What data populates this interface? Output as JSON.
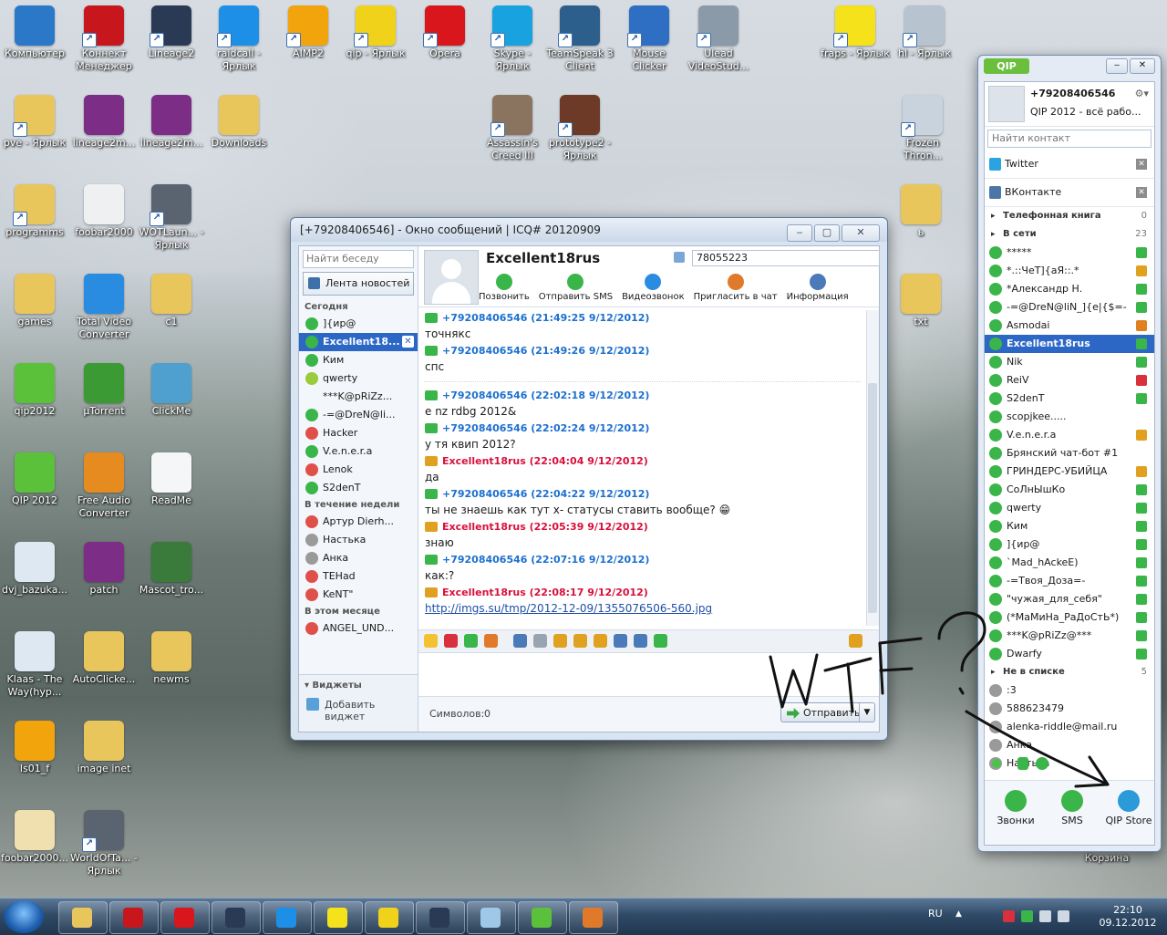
{
  "desktop": {
    "icons": [
      {
        "label": "Компьютер",
        "color": "#2b78c8",
        "shortcut": false
      },
      {
        "label": "Коннект Менеджер",
        "color": "#c8161d",
        "shortcut": true
      },
      {
        "label": "Lineage2",
        "color": "#2a3a55",
        "shortcut": true
      },
      {
        "label": "raidcall - Ярлык",
        "color": "#1e8fe6",
        "shortcut": true
      },
      {
        "label": "AIMP2",
        "color": "#f2a40d",
        "shortcut": true
      },
      {
        "label": "qip - Ярлык",
        "color": "#f1d21b",
        "shortcut": true
      },
      {
        "label": "Opera",
        "color": "#d8161c",
        "shortcut": true
      },
      {
        "label": "Skype - Ярлык",
        "color": "#19a2e0",
        "shortcut": true
      },
      {
        "label": "TeamSpeak 3 Client",
        "color": "#2d5f8d",
        "shortcut": true
      },
      {
        "label": "Mouse Clicker",
        "color": "#2e6fc4",
        "shortcut": true
      },
      {
        "label": "Ulead VideoStud...",
        "color": "#8b9aa8",
        "shortcut": true
      },
      {
        "label": "fraps - Ярлык",
        "color": "#f5e21a",
        "shortcut": true
      },
      {
        "label": "hl - Ярлык",
        "color": "#b7c3cf",
        "shortcut": true
      },
      {
        "label": "pve - Ярлык",
        "color": "#e8c65b",
        "shortcut": true
      },
      {
        "label": "lineage2m...",
        "color": "#7c2e86",
        "shortcut": false
      },
      {
        "label": "lineage2m...",
        "color": "#7c2e86",
        "shortcut": false
      },
      {
        "label": "Downloads",
        "color": "#e8c65b",
        "shortcut": false
      },
      {
        "label": "Assassin's Creed III",
        "color": "#8a7460",
        "shortcut": true
      },
      {
        "label": "prototype2 - Ярлык",
        "color": "#6d3a28",
        "shortcut": true
      },
      {
        "label": "Frozen Thron...",
        "color": "#c9d3de",
        "shortcut": true
      },
      {
        "label": "programms",
        "color": "#e8c65b",
        "shortcut": true
      },
      {
        "label": "foobar2000",
        "color": "#eef0f2",
        "shortcut": false
      },
      {
        "label": "WOTLaun... - Ярлык",
        "color": "#5a6470",
        "shortcut": true
      },
      {
        "label": "games",
        "color": "#e8c65b",
        "shortcut": false
      },
      {
        "label": "Total Video Converter",
        "color": "#2a8ce0",
        "shortcut": false
      },
      {
        "label": "c1",
        "color": "#e8c65b",
        "shortcut": false
      },
      {
        "label": "qip2012",
        "color": "#5cc13a",
        "shortcut": false
      },
      {
        "label": "µTorrent",
        "color": "#3c9a35",
        "shortcut": false
      },
      {
        "label": "ClickMe",
        "color": "#4fa0cf",
        "shortcut": false
      },
      {
        "label": "QIP 2012",
        "color": "#5cc13a",
        "shortcut": false
      },
      {
        "label": "Free Audio Converter",
        "color": "#e58b1f",
        "shortcut": false
      },
      {
        "label": "ReadMe",
        "color": "#f4f6f8",
        "shortcut": false
      },
      {
        "label": "dvj_bazuka...",
        "color": "#dde8f3",
        "shortcut": false
      },
      {
        "label": "patch",
        "color": "#7c2e86",
        "shortcut": false
      },
      {
        "label": "Mascot_tro...",
        "color": "#3a7a3a",
        "shortcut": false
      },
      {
        "label": "Klaas - The Way(hyp...",
        "color": "#dde8f3",
        "shortcut": false
      },
      {
        "label": "AutoClicke...",
        "color": "#e8c65b",
        "shortcut": false
      },
      {
        "label": "newms",
        "color": "#e8c65b",
        "shortcut": false
      },
      {
        "label": "ls01_f",
        "color": "#f2a40d",
        "shortcut": false
      },
      {
        "label": "image inet",
        "color": "#e8c65b",
        "shortcut": false
      },
      {
        "label": "foobar2000...",
        "color": "#f0e0b0",
        "shortcut": false
      },
      {
        "label": "WorldOfTa... - Ярлык",
        "color": "#5a6470",
        "shortcut": true
      },
      {
        "label": "ь",
        "color": "#e8c65b",
        "shortcut": false
      },
      {
        "label": "txt",
        "color": "#e8c65b",
        "shortcut": false
      },
      {
        "label": "Корзина",
        "color": "#c9d3de",
        "shortcut": false
      }
    ]
  },
  "msgwin": {
    "title": "[+79208406546] - Окно сообщений | ICQ# 20120909",
    "search_placeholder": "Найти беседу",
    "news_label": "Лента новостей",
    "sections": [
      {
        "title": "Сегодня",
        "items": [
          {
            "label": "]{ир@",
            "flower": "#3ab54a",
            "selected": false
          },
          {
            "label": "Excellent18...",
            "flower": "#3ab54a",
            "selected": true
          },
          {
            "label": "Ким",
            "flower": "#3ab54a",
            "selected": false
          },
          {
            "label": "qwerty",
            "flower": "#9acb3c",
            "selected": false
          },
          {
            "label": "***K@pRiZz...",
            "flower": "",
            "selected": false
          },
          {
            "label": "-=@DreN@li...",
            "flower": "#3ab54a",
            "selected": false
          },
          {
            "label": "Hacker",
            "flower": "#e0504a",
            "selected": false
          },
          {
            "label": "V.e.n.e.r.a",
            "flower": "#3ab54a",
            "selected": false
          },
          {
            "label": "Lenok",
            "flower": "#e0504a",
            "selected": false
          },
          {
            "label": "S2denT",
            "flower": "#3ab54a",
            "selected": false
          }
        ]
      },
      {
        "title": "В течение недели",
        "items": [
          {
            "label": "Артур Dierh...",
            "flower": "#e0504a",
            "selected": false
          },
          {
            "label": "Настька",
            "flower": "#9a9a9a",
            "selected": false
          },
          {
            "label": "Анка",
            "flower": "#9a9a9a",
            "selected": false
          },
          {
            "label": "TEHad",
            "flower": "#e0504a",
            "selected": false
          },
          {
            "label": "KeNT\"",
            "flower": "#e0504a",
            "selected": false
          }
        ]
      },
      {
        "title": "В этом месяце",
        "items": [
          {
            "label": "ANGEL_UND...",
            "flower": "#e0504a",
            "selected": false
          }
        ]
      }
    ],
    "widgets_label": "Виджеты",
    "add_widget_label": "Добавить виджет",
    "contact_name": "Excellent18rus",
    "contact_number": "78055223",
    "actions": [
      {
        "label": "Позвонить",
        "color": "#3ab54a"
      },
      {
        "label": "Отправить SMS",
        "color": "#3ab54a"
      },
      {
        "label": "Видеозвонок",
        "color": "#2a8ce0"
      },
      {
        "label": "Пригласить в чат",
        "color": "#e07a2a"
      },
      {
        "label": "Информация",
        "color": "#4a7ab8"
      }
    ],
    "messages": [
      {
        "who": "me",
        "header": "+79208406546 (21:49:25 9/12/2012)",
        "text": "точнякс"
      },
      {
        "who": "me",
        "header": "+79208406546 (21:49:26 9/12/2012)",
        "text": "спс"
      },
      {
        "who": "sep"
      },
      {
        "who": "me",
        "header": "+79208406546 (22:02:18 9/12/2012)",
        "text": "е nz rdbg 2012&"
      },
      {
        "who": "me",
        "header": "+79208406546 (22:02:24 9/12/2012)",
        "text": "у тя квип 2012?"
      },
      {
        "who": "them",
        "header": "Excellent18rus (22:04:04 9/12/2012)",
        "text": "да"
      },
      {
        "who": "me",
        "header": "+79208406546 (22:04:22 9/12/2012)",
        "text": "ты не знаешь как тут х- статусы ставить вообще? 😁"
      },
      {
        "who": "them",
        "header": "Excellent18rus (22:05:39 9/12/2012)",
        "text": "знаю"
      },
      {
        "who": "me",
        "header": "+79208406546 (22:07:16 9/12/2012)",
        "text": "как:?"
      },
      {
        "who": "them",
        "header": "Excellent18rus (22:08:17 9/12/2012)",
        "text": "http://imgs.su/tmp/2012-12-09/1355076506-560.jpg",
        "link": true
      }
    ],
    "chars_label": "Символов:",
    "chars_count": "0",
    "send_label": "Отправить"
  },
  "qip": {
    "tab_label": "QIP",
    "phone": "+79208406546",
    "status": "QIP 2012 - всё рабо...",
    "search_placeholder": "Найти контакт",
    "services": [
      {
        "label": "Twitter",
        "color": "#2aa3e0"
      },
      {
        "label": "ВКонтакте",
        "color": "#4a76a8"
      }
    ],
    "phonebook_label": "Телефонная книга",
    "phonebook_count": "0",
    "online_label": "В сети",
    "online_count": "23",
    "contacts": [
      {
        "label": "*****",
        "flower": "#3ab54a",
        "ricon": "#3ab54a",
        "selected": false
      },
      {
        "label": "*.::ЧеТ]{аЯ::.*",
        "flower": "#3ab54a",
        "ricon": "#e0a020",
        "selected": false
      },
      {
        "label": "*Александр Н.",
        "flower": "#3ab54a",
        "ricon": "#3ab54a",
        "selected": false
      },
      {
        "label": "-=@DreN@liN_]{e|{$=-",
        "flower": "#3ab54a",
        "ricon": "#3ab54a",
        "selected": false
      },
      {
        "label": "Asmodai",
        "flower": "#3ab54a",
        "ricon": "#e08020",
        "selected": false
      },
      {
        "label": "Excellent18rus",
        "flower": "#3ab54a",
        "ricon": "#3ab54a",
        "selected": true
      },
      {
        "label": "Nik",
        "flower": "#3ab54a",
        "ricon": "#3ab54a",
        "selected": false
      },
      {
        "label": "ReiV",
        "flower": "#3ab54a",
        "ricon": "#d8303c",
        "selected": false
      },
      {
        "label": "S2denT",
        "flower": "#3ab54a",
        "ricon": "#3ab54a",
        "selected": false
      },
      {
        "label": "scopjkee.....",
        "flower": "#3ab54a",
        "ricon": "",
        "selected": false
      },
      {
        "label": "V.e.n.e.r.a",
        "flower": "#3ab54a",
        "ricon": "#e0a020",
        "selected": false
      },
      {
        "label": "Брянский чат-бот #1",
        "flower": "#3ab54a",
        "ricon": "",
        "selected": false
      },
      {
        "label": "ГРИНДЕРС-УБИЙЦА",
        "flower": "#3ab54a",
        "ricon": "#e0a020",
        "selected": false
      },
      {
        "label": "СоЛнЫшКо",
        "flower": "#3ab54a",
        "ricon": "#3ab54a",
        "selected": false
      },
      {
        "label": "qwerty",
        "flower": "#3ab54a",
        "ricon": "#3ab54a",
        "selected": false
      },
      {
        "label": "Ким",
        "flower": "#3ab54a",
        "ricon": "#3ab54a",
        "selected": false
      },
      {
        "label": "]{ир@",
        "flower": "#3ab54a",
        "ricon": "#3ab54a",
        "selected": false
      },
      {
        "label": "`Mad_hAckeE)",
        "flower": "#3ab54a",
        "ricon": "#3ab54a",
        "selected": false
      },
      {
        "label": "-=Твоя_Доза=-",
        "flower": "#3ab54a",
        "ricon": "#3ab54a",
        "selected": false
      },
      {
        "label": "\"чужая_для_себя\"",
        "flower": "#3ab54a",
        "ricon": "#3ab54a",
        "selected": false
      },
      {
        "label": "(*МаМиНа_РаДоСтЬ*)",
        "flower": "#3ab54a",
        "ricon": "#3ab54a",
        "selected": false
      },
      {
        "label": "***K@pRiZz@***",
        "flower": "#3ab54a",
        "ricon": "#3ab54a",
        "selected": false
      },
      {
        "label": "Dwarfy",
        "flower": "#3ab54a",
        "ricon": "#3ab54a",
        "selected": false
      }
    ],
    "offline_label": "Не в списке",
    "offline_count": "5",
    "offline": [
      {
        "label": ":3",
        "flower": "#9a9a9a"
      },
      {
        "label": "588623479",
        "flower": "#9a9a9a"
      },
      {
        "label": "alenka-riddle@mail.ru",
        "flower": "#9a9a9a"
      },
      {
        "label": "Анка",
        "flower": "#9a9a9a"
      },
      {
        "label": "Настька",
        "flower": "#9a9a9a"
      }
    ],
    "bottom": [
      {
        "label": "Звонки",
        "color": "#3ab54a"
      },
      {
        "label": "SMS",
        "color": "#3ab54a"
      },
      {
        "label": "QIP Store",
        "color": "#2a9ad8"
      }
    ]
  },
  "annotation": {
    "text": "WTF?"
  },
  "taskbar": {
    "items": [
      {
        "color": "#e8c65b"
      },
      {
        "color": "#c8161d"
      },
      {
        "color": "#d8161c"
      },
      {
        "color": "#2a3a55"
      },
      {
        "color": "#1e8fe6"
      },
      {
        "color": "#f5e21a"
      },
      {
        "color": "#f1d21b"
      },
      {
        "color": "#2a3a55"
      },
      {
        "color": "#9fc8e8"
      },
      {
        "color": "#5cc13a"
      },
      {
        "color": "#e07a2a"
      }
    ],
    "lang": "RU",
    "time": "22:10",
    "date": "09.12.2012"
  }
}
